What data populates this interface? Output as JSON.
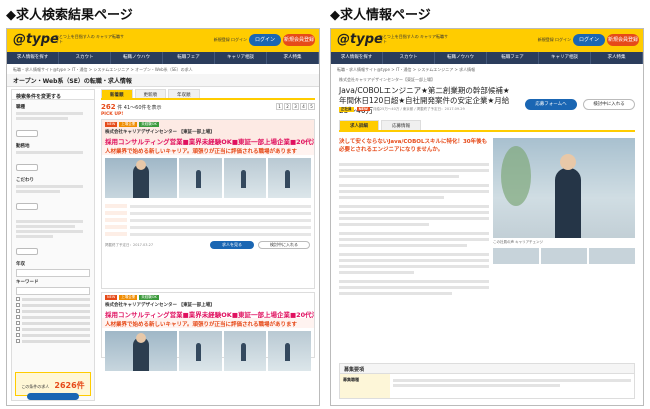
{
  "labels": {
    "left": "◆求人検索結果ページ",
    "right": "◆求人情報ページ"
  },
  "site": {
    "logo": "@type",
    "tagline": "ひとつ上を目指す人の キャリア転職サイト",
    "header_links": "新規登録 ログイン",
    "login": "ログイン",
    "register": "新規会員登録",
    "nav": [
      "求人情報を探す",
      "スカウト",
      "転職ノウハウ",
      "転職フェア",
      "キャリア相談",
      "求人特集"
    ]
  },
  "left": {
    "breadcrumb": "転職・求人情報サイト@type > IT・通信 > システムエンジニア > オープン・Web系（SE）の求人",
    "page_title": "オープン・Web系（SE）の転職・求人情報",
    "sidebar": {
      "title": "検索条件を変更する",
      "heads": [
        "職種",
        "勤務地",
        "こだわり",
        "年収",
        "キーワード"
      ],
      "count_label": "この条件の求人",
      "count": "2626件"
    },
    "tabs": [
      "新着順",
      "更新順",
      "年収順"
    ],
    "count_text": "262",
    "count_suffix": "件 41〜60件を表示",
    "pager": [
      "1",
      "2",
      "3",
      "4",
      "5"
    ],
    "pickup": "PICK UP!",
    "cards": [
      {
        "badges": [
          "NEW",
          "上場企業",
          "未経験OK"
        ],
        "company": "株式会社キャリアデザインセンター 【東証一部上場】",
        "title": "採用コンサルティング営業■業界未経験OK■東証一部上場企業■20代活躍中",
        "catch": "人材業界で始める新しいキャリア。頑張りが正当に評価される職場があります",
        "date": "掲載終了予定日：2017.03.27",
        "detail": "求人を見る",
        "save": "検討中に入れる"
      },
      {
        "badges": [
          "NEW",
          "上場企業",
          "未経験OK"
        ],
        "company": "株式会社キャリアデザインセンター 【東証一部上場】",
        "title": "採用コンサルティング営業■業界未経験OK■東証一部上場企業■20代活躍中",
        "catch": "人材業界で始める新しいキャリア。頑張りが正当に評価される職場があります"
      }
    ]
  },
  "right": {
    "breadcrumb": "転職・求人情報サイト@type > IT・通信 > システムエンジニア > 求人情報",
    "company_line": "株式会社キャリアデザインセンター【東証一部上場】",
    "title": "Java/COBOLエンジニア★第二創業期の幹部候補★年間休日120日超★自社開発案件の安定企業★月給25〜40万",
    "apply": "応募フォームへ",
    "save": "検討中に入れる",
    "meta_tags": [
      "正社員",
      "NEW"
    ],
    "meta_text": "月給25万〜40万 / 東京都 / 掲載終了予定日：2017.09.29",
    "tabs": [
      "求人詳細",
      "応募情報"
    ],
    "catch": "決して安くならないJava/COBOLスキルに特化！30年後も必要とされるエンジニアになりませんか。",
    "caption": "この社員の声 キャリアチェンジ",
    "summary_head": "募集要項",
    "summary_label": "募集職種"
  }
}
